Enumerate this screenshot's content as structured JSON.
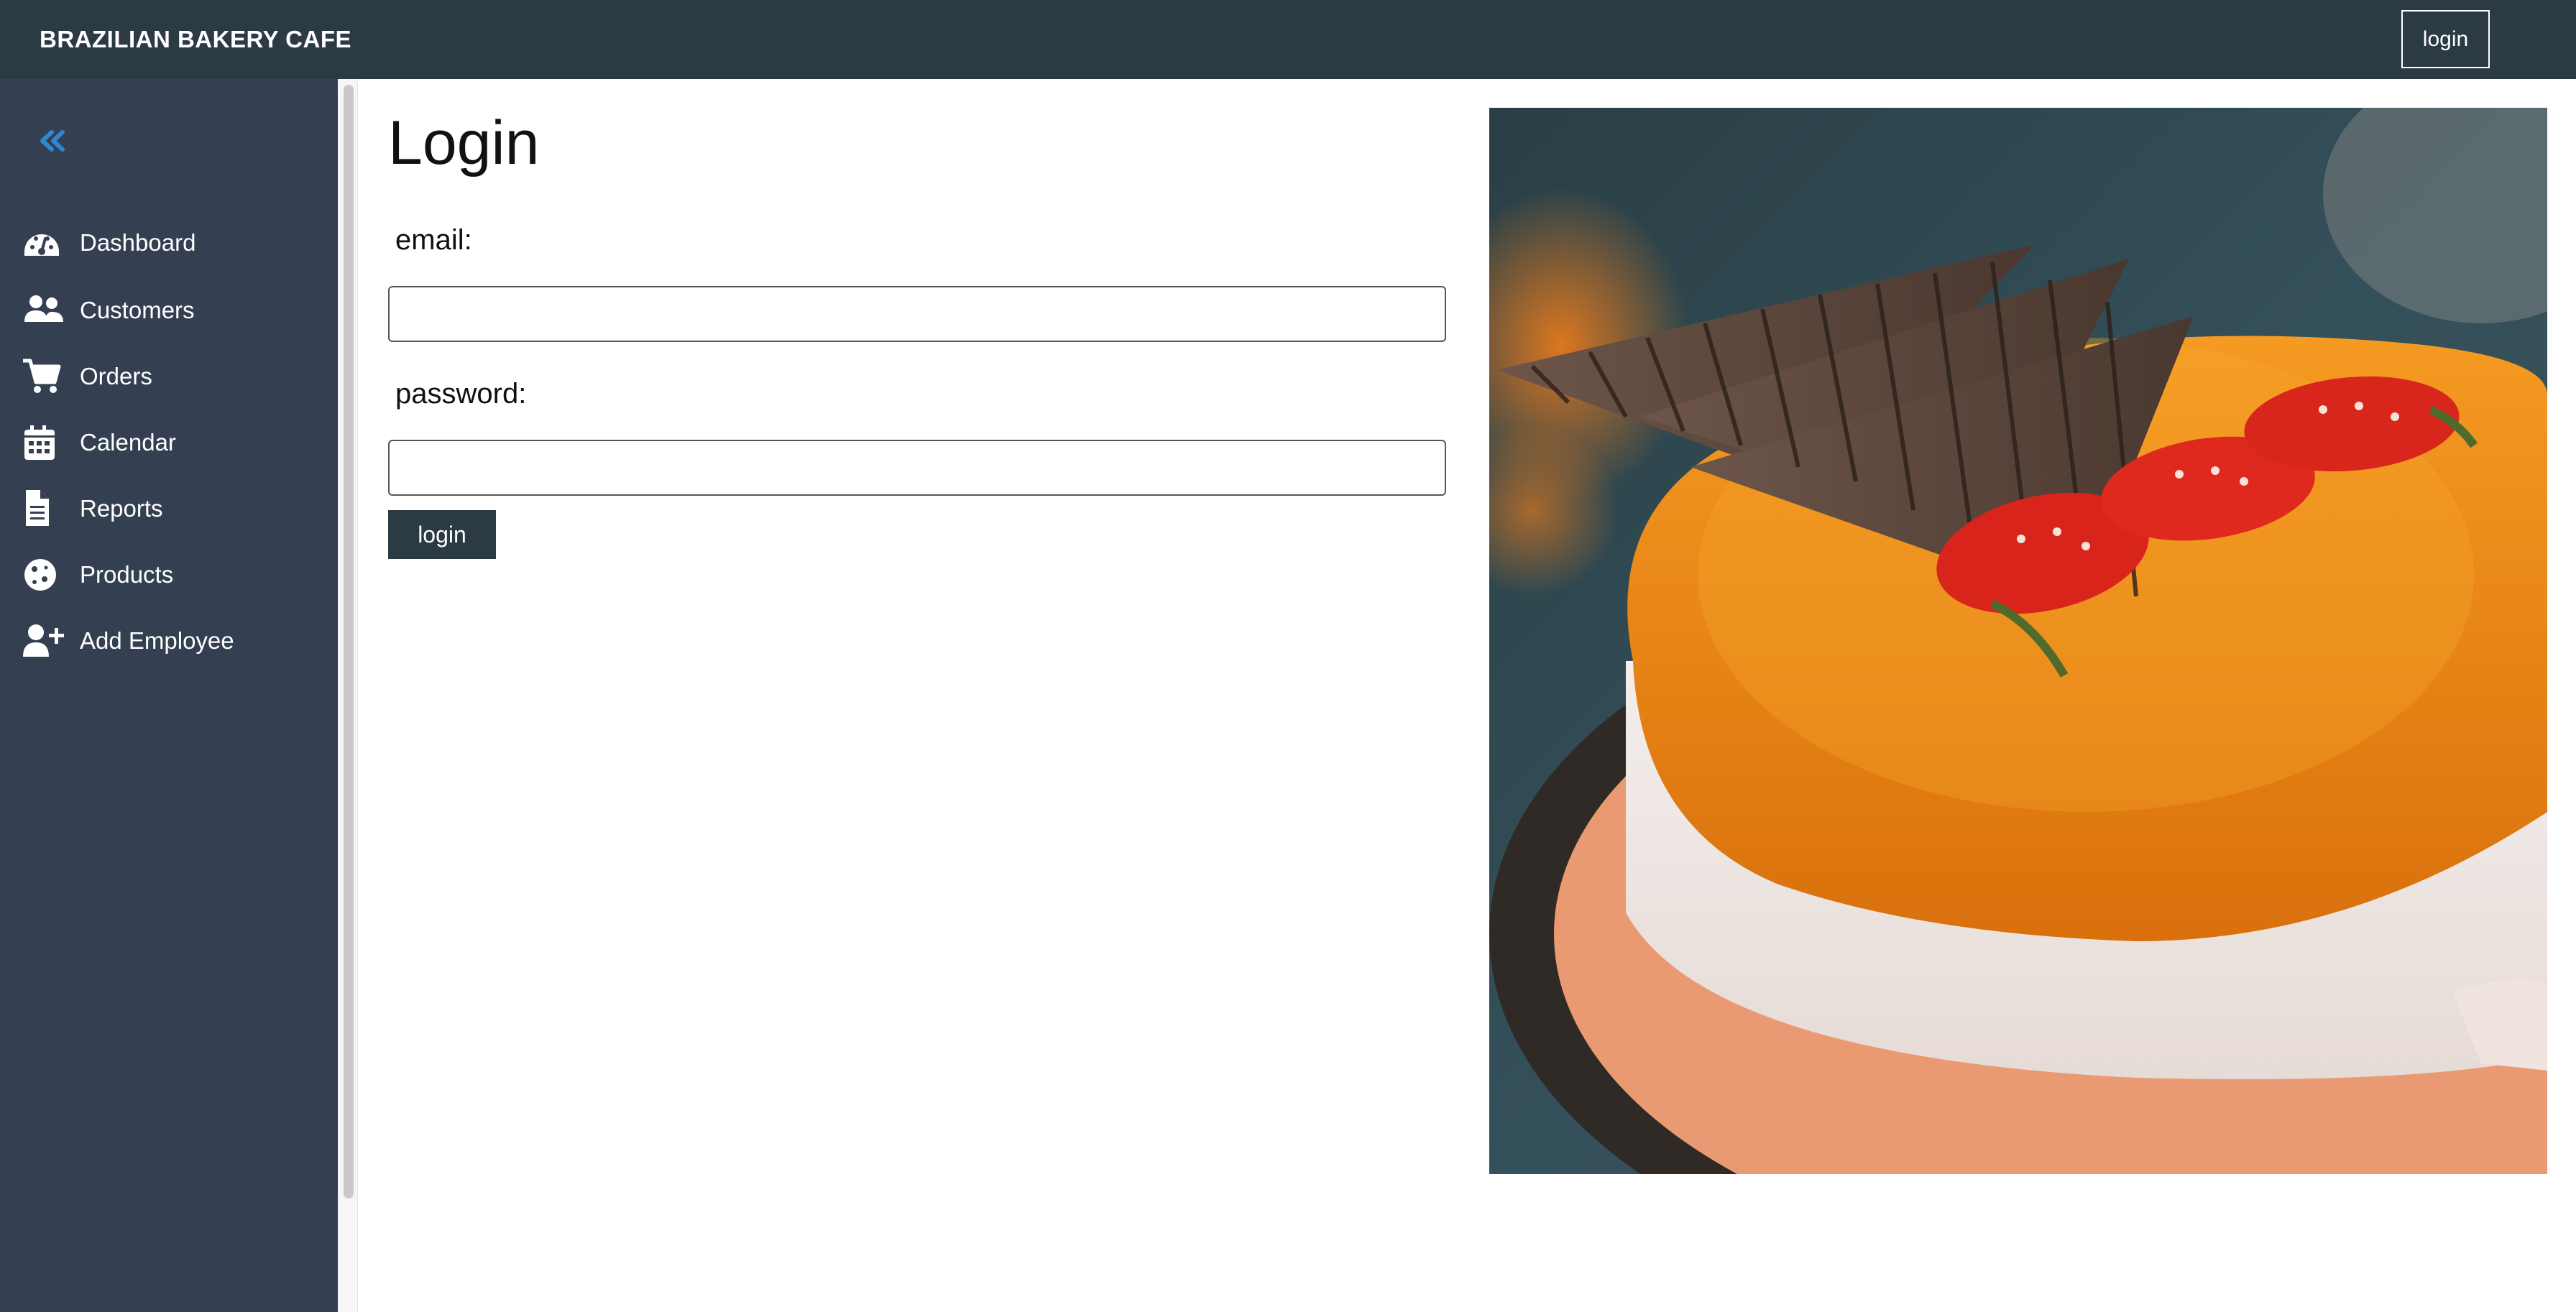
{
  "header": {
    "brand": "BRAZILIAN BAKERY CAFE",
    "login_label": "login"
  },
  "sidebar": {
    "collapse_icon": "double-chevron-left-icon",
    "accent_color": "#2e88d2",
    "items": [
      {
        "label": "Dashboard",
        "icon": "tachometer-icon"
      },
      {
        "label": "Customers",
        "icon": "users-icon"
      },
      {
        "label": "Orders",
        "icon": "shopping-cart-icon"
      },
      {
        "label": "Calendar",
        "icon": "calendar-icon"
      },
      {
        "label": "Reports",
        "icon": "file-icon"
      },
      {
        "label": "Products",
        "icon": "cookie-icon"
      },
      {
        "label": "Add Employee",
        "icon": "user-plus-icon"
      }
    ]
  },
  "main": {
    "title": "Login",
    "email_label": "email:",
    "email_value": "",
    "password_label": "password:",
    "password_value": "",
    "submit_label": "login"
  },
  "colors": {
    "topbar": "#2c3a44",
    "sidebar": "#343f51",
    "button": "#2c3a44"
  }
}
